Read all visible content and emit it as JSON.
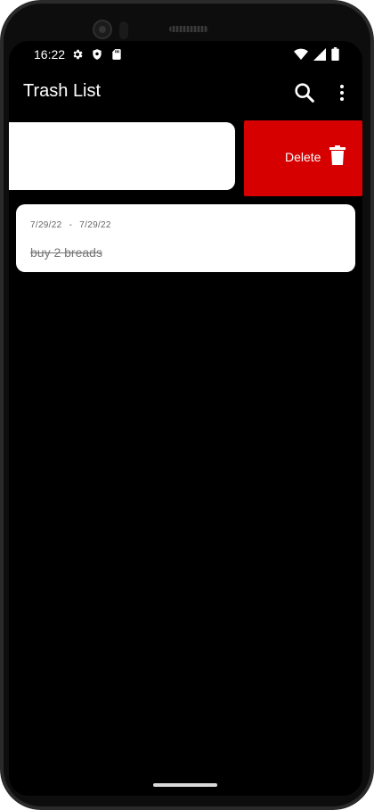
{
  "status_bar": {
    "time": "16:22",
    "left_icons": [
      "gear-icon",
      "shield-icon",
      "sd-card-icon"
    ],
    "right_icons": [
      "wifi-icon",
      "signal-icon",
      "battery-icon"
    ]
  },
  "app_bar": {
    "title": "Trash List",
    "actions": [
      "search-icon",
      "more-vert-icon"
    ]
  },
  "swiped_item": {
    "action_label": "Delete",
    "action_icon": "trash-icon",
    "action_color": "#d60000"
  },
  "items": [
    {
      "date_start": "7/29/22",
      "date_sep": "-",
      "date_end": "7/29/22",
      "title": "buy 2 breads",
      "completed": true
    }
  ]
}
